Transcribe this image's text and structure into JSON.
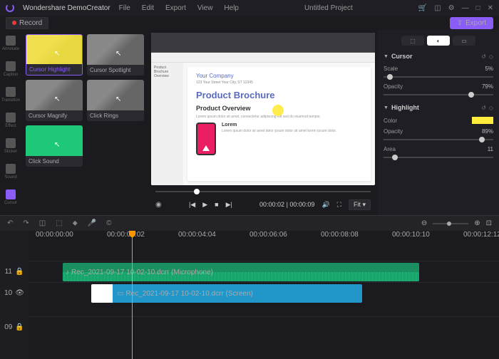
{
  "app": {
    "name": "Wondershare DemoCreator",
    "project": "Untitled Project"
  },
  "menu": [
    "File",
    "Edit",
    "Export",
    "View",
    "Help"
  ],
  "toolbar": {
    "record": "Record",
    "export": "Export"
  },
  "sidebar": [
    {
      "label": "Annotate"
    },
    {
      "label": "Caption"
    },
    {
      "label": "Transition"
    },
    {
      "label": "Effect"
    },
    {
      "label": "Sticker"
    },
    {
      "label": "Sound"
    },
    {
      "label": "Cursor"
    }
  ],
  "thumbs": [
    {
      "label": "Cursor Highlight"
    },
    {
      "label": "Cursor Spotlight"
    },
    {
      "label": "Cursor Magnify"
    },
    {
      "label": "Click Rings"
    },
    {
      "label": "Click Sound"
    }
  ],
  "doc": {
    "company": "Your Company",
    "meta": "123 Your Street\nYour City, ST 12345",
    "h1": "Product Brochure",
    "h2": "Product Overview",
    "text": "Lorem ipsum dolor sit amet, consectetur adipiscing elit sed do eiusmod tempor.",
    "h3": "Lorem",
    "col": "Lorem ipsum dolor sit amet dolor ipsum dolor sit amet lorem ipsum dolor."
  },
  "controls": {
    "time": "00:00:02 | 00:00:09",
    "fit": "Fit"
  },
  "props": {
    "cursor": {
      "title": "Cursor",
      "scale_label": "Scale",
      "scale": "5%",
      "opacity_label": "Opacity",
      "opacity": "79%"
    },
    "highlight": {
      "title": "Highlight",
      "color_label": "Color",
      "opacity_label": "Opacity",
      "opacity": "89%",
      "area_label": "Area",
      "area": "11"
    }
  },
  "ruler": [
    "00:00:00:00",
    "00:00:02:02",
    "00:00:04:04",
    "00:00:06:06",
    "00:00:08:08",
    "00:00:10:10",
    "00:00:12:12"
  ],
  "tracks": {
    "t11": "11",
    "t10": "10",
    "t09": "09",
    "audio": "Rec_2021-09-17 10-02-10.dcrr (Microphone)",
    "video": "Rec_2021-09-17 10-02-10.dcrr (Screen)"
  }
}
